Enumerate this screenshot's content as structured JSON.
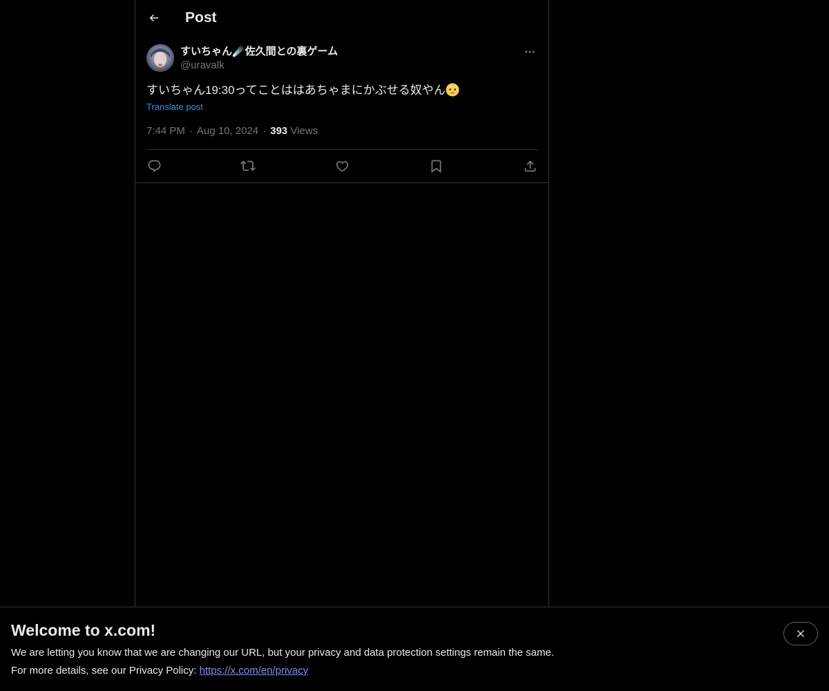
{
  "header": {
    "title": "Post"
  },
  "post": {
    "display_name": "すいちゃん☄️佐久間との裏ゲーム",
    "handle": "@uravalk",
    "text": "すいちゃん19:30ってことははあちゃまにかぶせる奴やん",
    "text_emoji": "pleading-face",
    "translate_label": "Translate post",
    "time": "7:44 PM",
    "date": "Aug 10, 2024",
    "views_count": "393",
    "views_label": "Views"
  },
  "actions": [
    {
      "name": "reply",
      "icon": "reply-icon"
    },
    {
      "name": "repost",
      "icon": "repost-icon"
    },
    {
      "name": "like",
      "icon": "like-icon"
    },
    {
      "name": "bookmark",
      "icon": "bookmark-icon"
    },
    {
      "name": "share",
      "icon": "share-icon"
    }
  ],
  "banner": {
    "title": "Welcome to x.com!",
    "line1": "We are letting you know that we are changing our URL, but your privacy and data protection settings remain the same.",
    "line2_prefix": "For more details, see our Privacy Policy: ",
    "privacy_link": "https://x.com/en/privacy"
  },
  "colors": {
    "background": "#000000",
    "text_primary": "#e7e9ea",
    "text_secondary": "#71767b",
    "link": "#1d9bf0",
    "border": "#2f3336"
  }
}
